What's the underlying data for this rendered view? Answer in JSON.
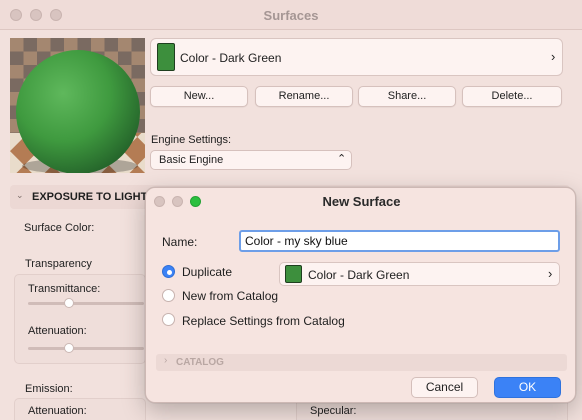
{
  "window": {
    "title": "Surfaces"
  },
  "material": {
    "selected": "Color - Dark Green",
    "swatch_color": "#3d8f3d"
  },
  "actions": {
    "new": "New...",
    "rename": "Rename...",
    "share": "Share...",
    "delete": "Delete..."
  },
  "engine": {
    "label": "Engine Settings:",
    "value": "Basic Engine"
  },
  "section": {
    "title": "EXPOSURE TO LIGHT"
  },
  "background_labels": {
    "surface_color": "Surface Color:",
    "transparency": "Transparency",
    "transmittance": "Transmittance:",
    "attenuation": "Attenuation:",
    "emission": "Emission:",
    "attenuation2": "Attenuation:",
    "specular": "Specular:"
  },
  "dialog": {
    "title": "New Surface",
    "name_label": "Name:",
    "name_value": "Color - my sky blue",
    "options": [
      "Duplicate",
      "New from Catalog",
      "Replace Settings from Catalog"
    ],
    "selected_option": "Duplicate",
    "source_surface": "Color - Dark Green",
    "catalog_label": "CATALOG",
    "cancel": "Cancel",
    "ok": "OK"
  },
  "colors": {
    "accent": "#3b82f6",
    "swatch": "#3d8f3d"
  }
}
